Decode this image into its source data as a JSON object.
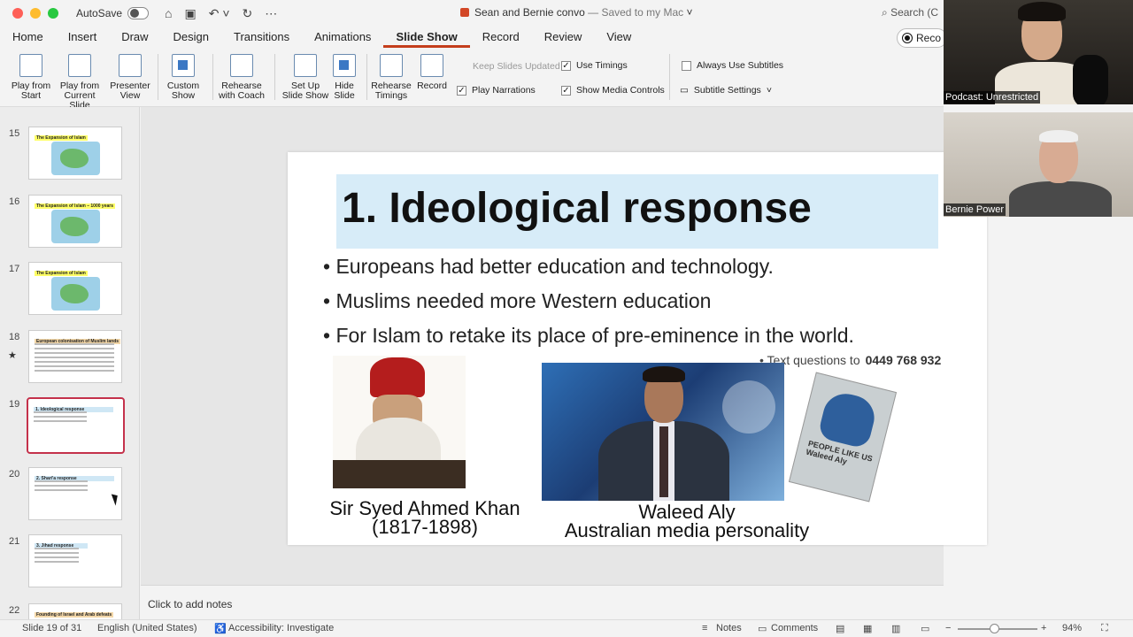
{
  "titlebar": {
    "autosave_label": "AutoSave",
    "doc_title": "Sean and Bernie convo",
    "saved_status": "— Saved to my Mac",
    "search_placeholder": "Search (C"
  },
  "tabs": [
    "Home",
    "Insert",
    "Draw",
    "Design",
    "Transitions",
    "Animations",
    "Slide Show",
    "Record",
    "Review",
    "View"
  ],
  "active_tab": "Slide Show",
  "record_button": "Reco",
  "ribbon": {
    "play_from_start": "Play from Start",
    "play_from_current": "Play from Current Slide",
    "presenter_view": "Presenter View",
    "custom_show": "Custom Show",
    "rehearse_with_coach": "Rehearse with Coach",
    "set_up_slide_show": "Set Up Slide Show",
    "hide_slide": "Hide Slide",
    "rehearse_timings": "Rehearse Timings",
    "record": "Record",
    "keep_slides_updated": "Keep Slides Updated",
    "use_timings": "Use Timings",
    "play_narrations": "Play Narrations",
    "show_media_controls": "Show Media Controls",
    "always_use_subtitles": "Always Use Subtitles",
    "subtitle_settings": "Subtitle Settings"
  },
  "thumbnails": [
    {
      "num": "15",
      "title": "The Expansion of Islam"
    },
    {
      "num": "16",
      "title": "The Expansion of Islam – 1000 years"
    },
    {
      "num": "17",
      "title": "The Expansion of Islam"
    },
    {
      "num": "18",
      "title": "European colonisation of Muslim lands"
    },
    {
      "num": "19",
      "title": "1. Ideological response"
    },
    {
      "num": "20",
      "title": "2. Shari'a response"
    },
    {
      "num": "21",
      "title": "3. Jihad response"
    },
    {
      "num": "22",
      "title": "Founding of Israel and Arab defeats"
    }
  ],
  "slide": {
    "title": "1. Ideological response",
    "bullets": [
      "• Europeans had better education and technology.",
      "•  Muslims needed more Western education",
      "• For Islam to retake its place of pre-eminence in the world."
    ],
    "text_questions": "Text questions to",
    "phone": "0449 768 932",
    "caption1_line1": "Sir Syed Ahmed Khan",
    "caption1_line2": "(1817-1898)",
    "caption2_line1": "Waleed Aly",
    "caption2_line2": "Australian media personality",
    "book_text": "PEOPLE LIKE US Waleed Aly"
  },
  "notes_placeholder": "Click to add notes",
  "status": {
    "slide_count": "Slide 19 of 31",
    "language": "English (United States)",
    "accessibility": "Accessibility: Investigate",
    "notes": "Notes",
    "comments": "Comments",
    "zoom": "94%"
  },
  "video": {
    "label1": "Podcast: Unrestricted",
    "label2": "Bernie Power"
  }
}
